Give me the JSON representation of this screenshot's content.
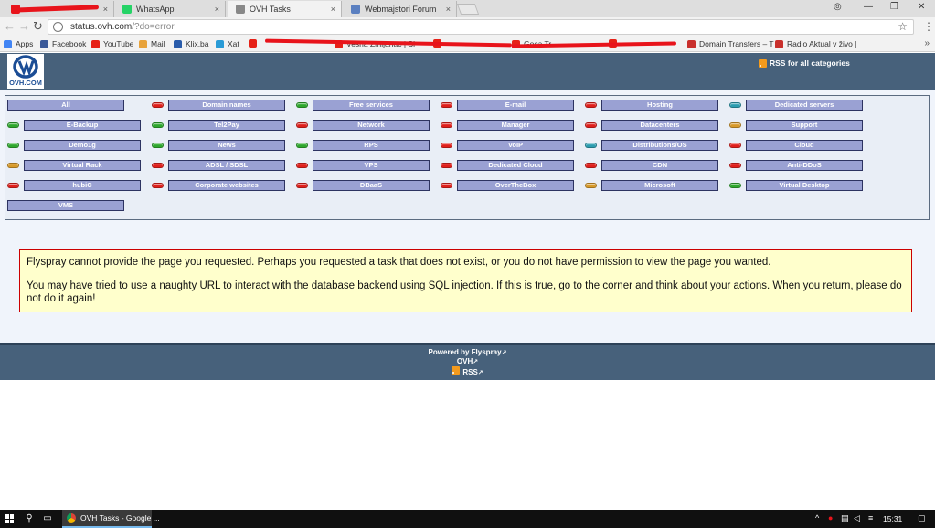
{
  "browser": {
    "tabs": [
      {
        "label": "",
        "favicon_color": "#e8141b",
        "active": false
      },
      {
        "label": "WhatsApp",
        "favicon_color": "#25d366",
        "active": false
      },
      {
        "label": "OVH Tasks",
        "favicon_color": "#888888",
        "active": true
      },
      {
        "label": "Webmajstori Forum",
        "favicon_color": "#5a7fc0",
        "active": false
      }
    ],
    "tab_close": "×",
    "url_host": "status.ovh.com",
    "url_path": "/?do=error",
    "info_icon": "i",
    "star_icon": "☆",
    "menu_icon": "⋮",
    "back_icon": "←",
    "forward_icon": "→",
    "reload_icon": "↻",
    "home_icon": "⌂",
    "account_icon": "◎",
    "minimize_icon": "—",
    "maximize_icon": "❐",
    "close_icon": "✕"
  },
  "bookmarks": [
    {
      "label": "Apps",
      "color": "#4285f4"
    },
    {
      "label": "Facebook",
      "color": "#3b5998"
    },
    {
      "label": "YouTube",
      "color": "#e62117"
    },
    {
      "label": "Mail",
      "color": "#e8a33b"
    },
    {
      "label": "Klix.ba",
      "color": "#2a5caa"
    },
    {
      "label": "Xat",
      "color": "#2a9bd6"
    },
    {
      "label": "",
      "color": "#e62117"
    },
    {
      "label": "Vesna Zmijanac | Sl",
      "color": "#e62117"
    },
    {
      "label": "",
      "color": "#e62117"
    },
    {
      "label": "Goca Tr",
      "color": "#e62117"
    },
    {
      "label": "",
      "color": "#e62117"
    },
    {
      "label": "Domain Transfers – T",
      "color": "#c9302c"
    },
    {
      "label": "Radio Aktual v živo |",
      "color": "#c9302c"
    }
  ],
  "bookmarks_more": "»",
  "site": {
    "logo_text": "OVH.COM",
    "rss_all": "RSS for all categories"
  },
  "categories": [
    {
      "label": "All",
      "status": "none"
    },
    {
      "label": "Domain names",
      "status": "red"
    },
    {
      "label": "Free services",
      "status": "green"
    },
    {
      "label": "E-mail",
      "status": "red"
    },
    {
      "label": "Hosting",
      "status": "red"
    },
    {
      "label": "Dedicated servers",
      "status": "teal"
    },
    {
      "label": "E-Backup",
      "status": "green"
    },
    {
      "label": "Tel2Pay",
      "status": "green"
    },
    {
      "label": "Network",
      "status": "red"
    },
    {
      "label": "Manager",
      "status": "red"
    },
    {
      "label": "Datacenters",
      "status": "red"
    },
    {
      "label": "Support",
      "status": "orange"
    },
    {
      "label": "Demo1g",
      "status": "green"
    },
    {
      "label": "News",
      "status": "green"
    },
    {
      "label": "RPS",
      "status": "green"
    },
    {
      "label": "VoIP",
      "status": "red"
    },
    {
      "label": "Distributions/OS",
      "status": "teal"
    },
    {
      "label": "Cloud",
      "status": "red"
    },
    {
      "label": "Virtual Rack",
      "status": "orange"
    },
    {
      "label": "ADSL / SDSL",
      "status": "red"
    },
    {
      "label": "VPS",
      "status": "red"
    },
    {
      "label": "Dedicated Cloud",
      "status": "red"
    },
    {
      "label": "CDN",
      "status": "red"
    },
    {
      "label": "Anti-DDoS",
      "status": "red"
    },
    {
      "label": "hubiC",
      "status": "red"
    },
    {
      "label": "Corporate websites",
      "status": "red"
    },
    {
      "label": "DBaaS",
      "status": "red"
    },
    {
      "label": "OverTheBox",
      "status": "red"
    },
    {
      "label": "Microsoft",
      "status": "orange"
    },
    {
      "label": "Virtual Desktop",
      "status": "green"
    },
    {
      "label": "VMS",
      "status": "none"
    }
  ],
  "error": {
    "line1": "Flyspray cannot provide the page you requested. Perhaps you requested a task that does not exist, or you do not have permission to view the page you wanted.",
    "line2": "You may have tried to use a naughty URL to interact with the database backend using SQL injection. If this is true, go to the corner and think about your actions. When you return, please do not do it again!"
  },
  "footer": {
    "powered": "Powered by Flyspray",
    "ovh": "OVH",
    "rss": "RSS",
    "ext_icon": "↗"
  },
  "taskbar": {
    "app_label": "OVH Tasks - Google ...",
    "time": "15:31",
    "search_icon": "⚲",
    "taskview_icon": "▭"
  }
}
